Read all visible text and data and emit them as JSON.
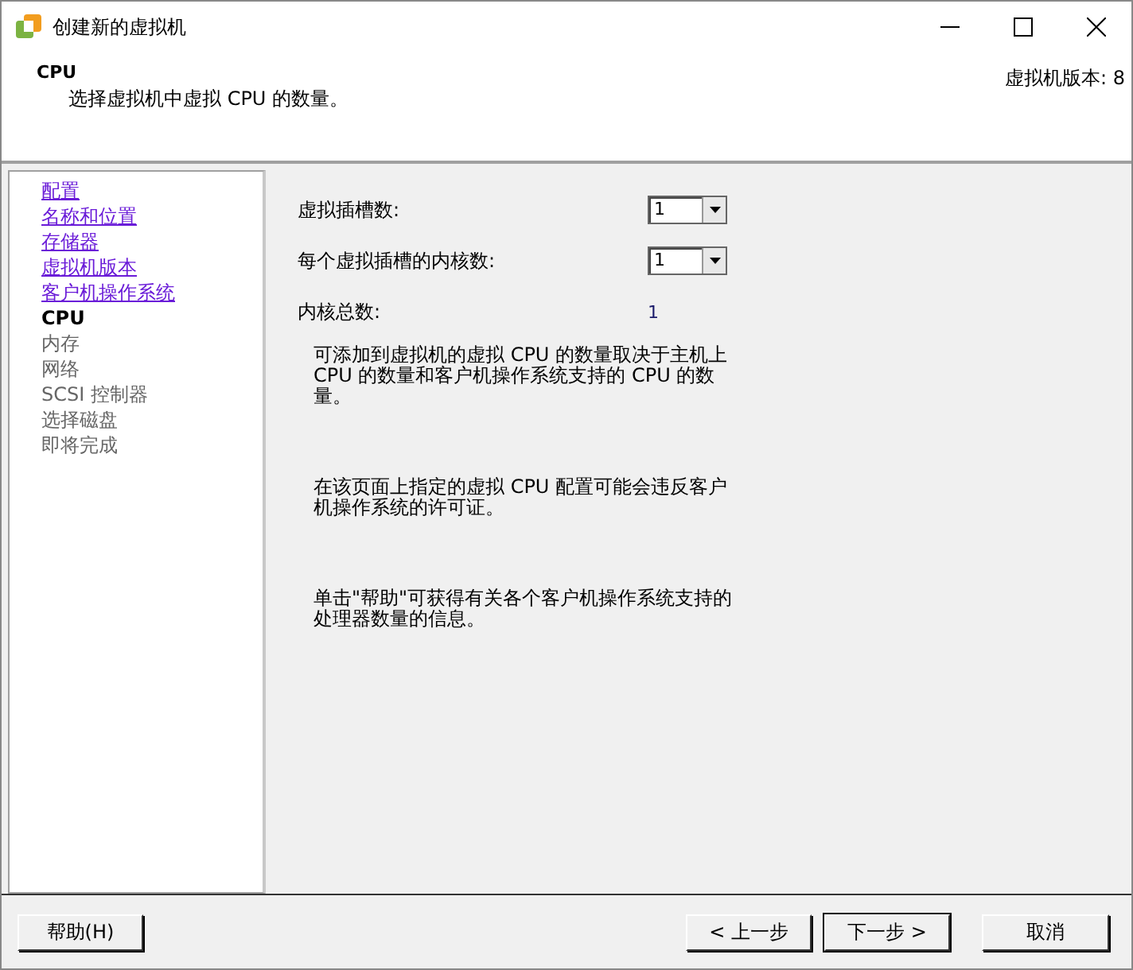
{
  "window": {
    "title": "创建新的虚拟机"
  },
  "header": {
    "title": "CPU",
    "subtitle": "选择虚拟机中虚拟 CPU 的数量。",
    "version": "虚拟机版本: 8"
  },
  "steps": [
    {
      "label": "配置",
      "kind": "visited"
    },
    {
      "label": "名称和位置",
      "kind": "visited"
    },
    {
      "label": "存储器",
      "kind": "visited"
    },
    {
      "label": "虚拟机版本",
      "kind": "visited"
    },
    {
      "label": "客户机操作系统",
      "kind": "visited"
    },
    {
      "label": "CPU",
      "kind": "current"
    },
    {
      "label": "内存",
      "kind": "upcoming"
    },
    {
      "label": "网络",
      "kind": "upcoming"
    },
    {
      "label": "SCSI 控制器",
      "kind": "upcoming"
    },
    {
      "label": "选择磁盘",
      "kind": "upcoming"
    },
    {
      "label": "即将完成",
      "kind": "upcoming"
    }
  ],
  "fields": [
    {
      "label": "虚拟插槽数:",
      "kind": "dropdown",
      "value": "1"
    },
    {
      "label": "每个虚拟插槽的内核数:",
      "kind": "dropdown",
      "value": "1"
    },
    {
      "label": "内核总数:",
      "kind": "readout",
      "value": "1"
    }
  ],
  "notes": [
    "可添加到虚拟机的虚拟 CPU 的数量取决于主机上 CPU 的数量和客户机操作系统支持的 CPU 的数量。",
    "在该页面上指定的虚拟 CPU 配置可能会违反客户机操作系统的许可证。",
    "单击\"帮助\"可获得有关各个客户机操作系统支持的处理器数量的信息。"
  ],
  "buttons": {
    "help": "帮助(H)",
    "back": "< 上一步",
    "next": "下一步 >",
    "cancel": "取消"
  }
}
